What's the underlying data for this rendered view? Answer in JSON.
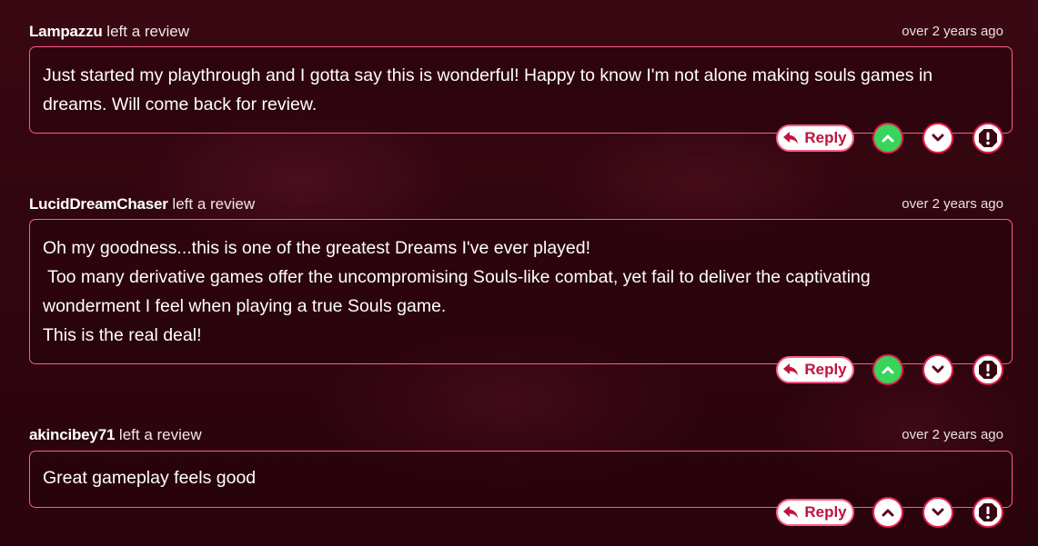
{
  "reviews": [
    {
      "author": "Lampazzu",
      "action": " left a review",
      "time": "over 2 years ago",
      "body": [
        "Just started my playthrough and I gotta say this is wonderful! Happy to know I'm not alone making souls games in",
        "dreams. Will come back for review."
      ],
      "reply_label": "Reply",
      "upvote_active": true
    },
    {
      "author": "LucidDreamChaser",
      "action": " left a review",
      "time": "over 2 years ago",
      "body": [
        "Oh my goodness...this is one of the greatest Dreams I've ever played!",
        " Too many derivative games offer the uncompromising Souls-like combat, yet fail to deliver the captivating",
        "wonderment I feel when playing a true Souls game.",
        "This is the real deal!"
      ],
      "reply_label": "Reply",
      "upvote_active": true
    },
    {
      "author": "akincibey71",
      "action": " left a review",
      "time": "over 2 years ago",
      "body": [
        "Great gameplay feels good"
      ],
      "reply_label": "Reply",
      "upvote_active": false
    }
  ],
  "icons": {
    "reply": "reply-arrow-icon",
    "upvote": "chevron-up-icon",
    "downvote": "chevron-down-icon",
    "report": "report-alert-icon"
  },
  "colors": {
    "accent": "#ff5c8a",
    "active_vote": "#39d45b",
    "reply_text": "#c2123c"
  }
}
